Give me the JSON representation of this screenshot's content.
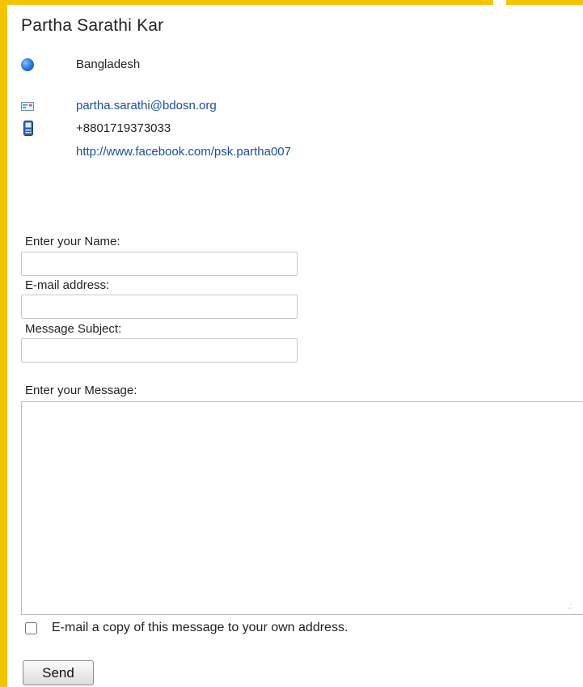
{
  "profile": {
    "name": "Partha Sarathi Kar",
    "location": "Bangladesh",
    "email": "partha.sarathi@bdosn.org",
    "phone": "+8801719373033",
    "website": "http://www.facebook.com/psk.partha007"
  },
  "icons": {
    "location": "globe-icon",
    "email": "envelope-icon",
    "phone": "mobile-phone-icon"
  },
  "form": {
    "name_label": "Enter your Name:",
    "name_value": "",
    "email_label": "E-mail address:",
    "email_value": "",
    "subject_label": "Message Subject:",
    "subject_value": "",
    "message_label": "Enter your Message:",
    "message_value": "",
    "copy_label": "E-mail a copy of this message to your own address.",
    "copy_checked": false,
    "send_label": "Send"
  },
  "colors": {
    "frame": "#f5c400",
    "link": "#1a4fa3"
  }
}
